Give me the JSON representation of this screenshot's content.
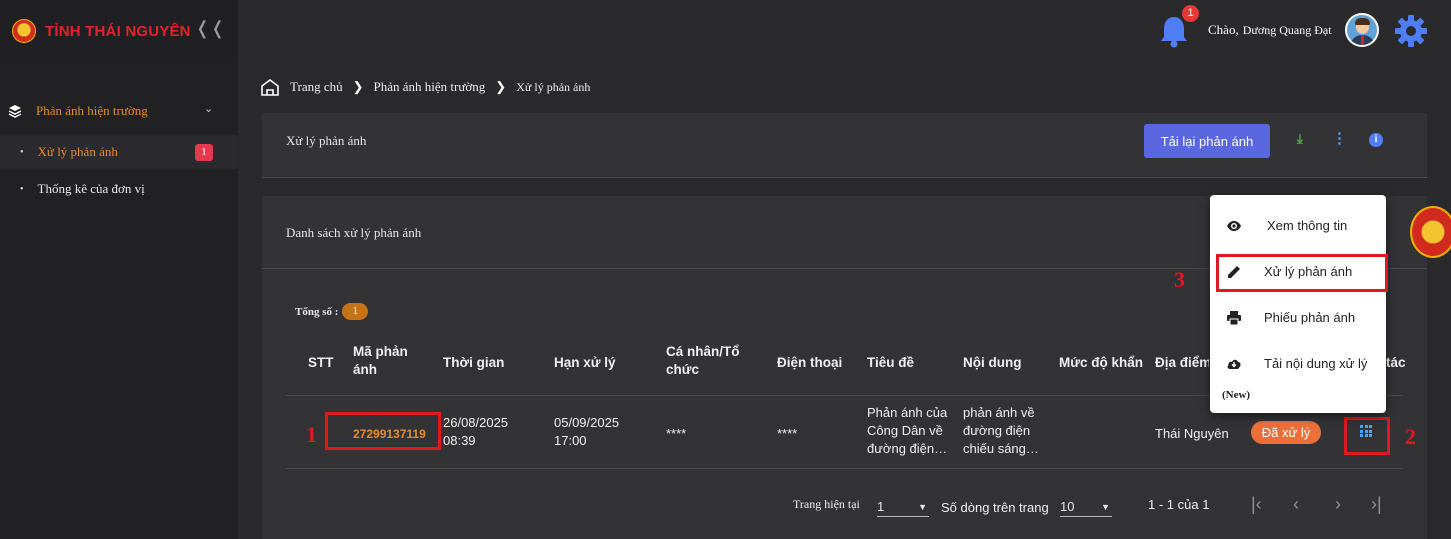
{
  "brand": {
    "title": "TỈNH THÁI NGUYÊN"
  },
  "header": {
    "notification_count": "1",
    "greeting": "Chào,",
    "user_name": "Dương Quang Đạt"
  },
  "sidebar": {
    "group": "Phản ánh hiện trường",
    "items": [
      {
        "label": "Xử lý phản ánh",
        "badge": "1",
        "active": true
      },
      {
        "label": "Thống kê của đơn vị",
        "active": false
      }
    ]
  },
  "breadcrumb": [
    "Trang chủ",
    "Phản ánh hiện trường",
    "Xử lý phản ánh"
  ],
  "top_card": {
    "title": "Xử lý phản ánh",
    "reload_button": "Tải lại phản ánh"
  },
  "list_card": {
    "title": "Danh sách xử lý phản ánh",
    "total_label": "Tổng số :",
    "total": "1",
    "columns": [
      "STT",
      "Mã phản ánh",
      "Thời gian",
      "Hạn xử lý",
      "Cá nhân/Tổ chức",
      "Điện thoại",
      "Tiêu đề",
      "Nội dung",
      "Mức độ khẩn",
      "Địa điểm",
      "Thao tác"
    ],
    "rows": [
      {
        "stt": "",
        "code": "27299137119",
        "time": "26/08/2025 08:39",
        "deadline": "05/09/2025 17:00",
        "person": "****",
        "phone": "****",
        "title": "Phản ánh của Công Dân về đường điện…",
        "content": "phản ánh về đường điện chiếu sáng…",
        "urgency": "",
        "location": "Thái Nguyên",
        "status": "Đã xử lý"
      }
    ],
    "column_visible_suffix": "tác"
  },
  "pagination": {
    "current_page_label": "Trang hiện tại",
    "current_page": "1",
    "rows_per_page_label": "Số dòng trên trang",
    "rows_per_page": "10",
    "range": "1 - 1 của 1"
  },
  "action_menu": {
    "items": [
      {
        "label": "Xem thông tin",
        "icon": "eye-icon"
      },
      {
        "label": "Xử lý phản ánh",
        "icon": "pencil-icon"
      },
      {
        "label": "Phiếu phản ánh",
        "icon": "printer-icon"
      },
      {
        "label": "Tải nội dung xử lý",
        "icon": "cloud-download-icon"
      }
    ],
    "new_tag": "(New)"
  },
  "annotations": [
    "1",
    "2",
    "3"
  ],
  "colors": {
    "accent_orange": "#e88b2a",
    "primary_button": "#5a67e0",
    "annotation_red": "#e0191f",
    "status_badge": "#ec6f3a"
  }
}
